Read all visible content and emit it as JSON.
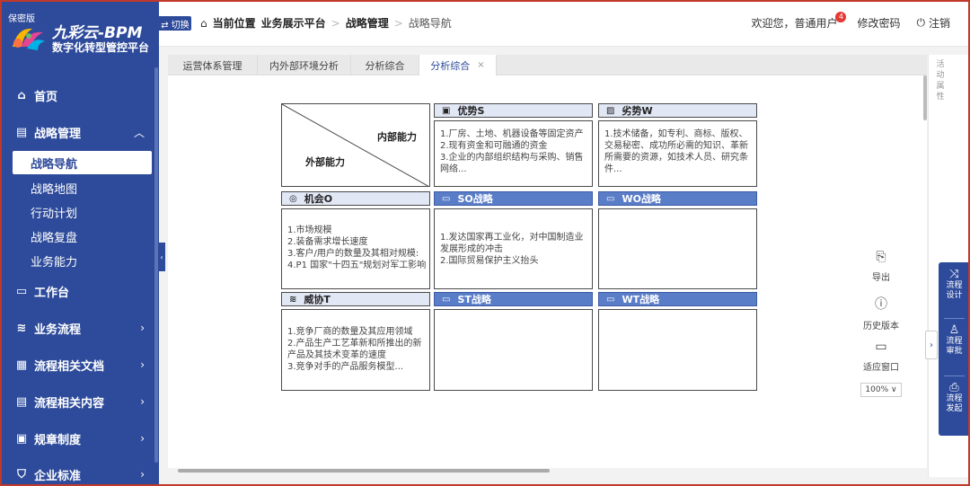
{
  "sidebar": {
    "secret_label": "保密版",
    "brand": "九彩云-BPM",
    "subtitle": "数字化转型管控平台",
    "nav": {
      "home": "首页",
      "strategy": "战略管理",
      "workbench": "工作台",
      "biz_process": "业务流程",
      "process_docs": "流程相关文档",
      "process_content": "流程相关内容",
      "rules": "规章制度",
      "enterprise_std": "企业标准"
    },
    "strategy_subs": [
      "战略导航",
      "战略地图",
      "行动计划",
      "战略复盘",
      "业务能力"
    ]
  },
  "topbar": {
    "switch_label": "⇄ 切换",
    "breadcrumb": {
      "home": "当前位置",
      "item1": "业务展示平台",
      "item2": "战略管理",
      "item3": "战略导航"
    },
    "welcome": "欢迎您，普通用户",
    "badge_count": "4",
    "change_password": "修改密码",
    "logout": "注销"
  },
  "tabs": [
    {
      "label": "运营体系管理"
    },
    {
      "label": "内外部环境分析"
    },
    {
      "label": "分析综合"
    },
    {
      "label": "分析综合"
    }
  ],
  "right_panel": {
    "vertical_text": "活动属性"
  },
  "swot": {
    "diag_inner": "内部能力",
    "diag_outer": "外部能力",
    "s_header": "优势S",
    "w_header": "劣势W",
    "o_header": "机会O",
    "t_header": "威协T",
    "so_header": "SO战略",
    "wo_header": "WO战略",
    "st_header": "ST战略",
    "wt_header": "WT战略",
    "s_text": [
      "1.厂房、土地、机器设备等固定资产",
      "2.现有资金和可融通的资金",
      "3.企业的内部组织结构与采购、销售网络..."
    ],
    "w_text": [
      "1.技术储备，如专利、商标、版权、交易秘密、成功所必需的知识、革新所需要的资源，如技术人员、研究条件..."
    ],
    "o_text": [
      "1.市场规模",
      "2.装备需求增长速度",
      "3.客户/用户的数量及其相对规模:",
      "4.P1 国家\"十四五\"规划对军工影响"
    ],
    "so_text": [
      "1.发达国家再工业化，对中国制造业发展形成的冲击",
      "2.国际贸易保护主义抬头"
    ],
    "t_text": [
      "1.竞争厂商的数量及其应用领域",
      "2.产品生产工艺革新和所推出的新产品及其技术变革的速度",
      "3.竞争对手的产品服务模型..."
    ]
  },
  "tools": {
    "export": "导出",
    "history": "历史版本",
    "fit_window": "适应窗口",
    "zoom": "100% ∨"
  },
  "flow_panel": {
    "design": "流程设计",
    "review": "流程审批",
    "launch": "流程发起"
  },
  "colors": {
    "sidebar_bg": "#2e4b9b",
    "strategy_header": "#5a7dc8",
    "header_fill": "#e2e7f5",
    "badge": "#e53935"
  }
}
